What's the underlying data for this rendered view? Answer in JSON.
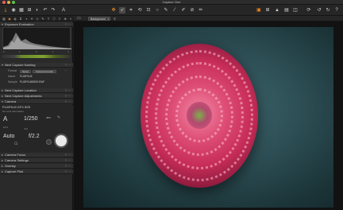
{
  "window": {
    "title": "Capture One"
  },
  "toolbar": {
    "left_icons": [
      "import-icon",
      "camera-icon",
      "browser-icon",
      "metadata-icon",
      "undo-icon",
      "redo-icon",
      "text-icon"
    ],
    "center_icons": [
      "pan-icon",
      "cursor-icon",
      "crop-icon",
      "rotate-icon",
      "keystone-icon",
      "spot-icon",
      "picker-icon",
      "brush-icon",
      "eraser-icon",
      "gradient-icon",
      "annotate-icon"
    ],
    "right_icons": [
      "grid-icon",
      "guides-icon",
      "exposure-warning-icon",
      "proof-icon",
      "compare-icon",
      "focus-icon",
      "copy-icon",
      "apply-icon"
    ]
  },
  "viewer_toolbar": {
    "background_label": "Background"
  },
  "panel": {
    "sections": {
      "exposure_evaluation": "Exposure Evaluation",
      "next_capture_naming": "Next Capture Naming",
      "next_capture_location": "Next Capture Location",
      "next_capture_adjustments": "Next Capture Adjustments",
      "camera": "Camera",
      "camera_focus": "Camera Focus",
      "camera_settings": "Camera Settings",
      "overlay": "Overlay",
      "capture_pilot": "Capture Pilot"
    },
    "exposure_scale": [
      "-2",
      "-1",
      "0",
      "1",
      "2"
    ],
    "naming": {
      "format_label": "Format",
      "format_chip_1": "Name",
      "format_chip_2": "Camera Counter",
      "name_label": "Name",
      "name_value": "FUJIFILM",
      "sample_label": "Sample",
      "sample_value": "FUJIFILM0000.RAF"
    },
    "camera": {
      "model": "FUJIFILM GFX 50S",
      "lens": "No Lens Information",
      "mode": "A",
      "shutter": "1/250",
      "iso_label": "ISO",
      "iso_value": "Auto",
      "aperture": "f/2.2",
      "ev": "±0.0",
      "jpg_label": "JPG"
    }
  },
  "colors": {
    "accent": "#f08a24",
    "meter_green": "#7fa232",
    "panel_bg": "#2a2a2a"
  }
}
